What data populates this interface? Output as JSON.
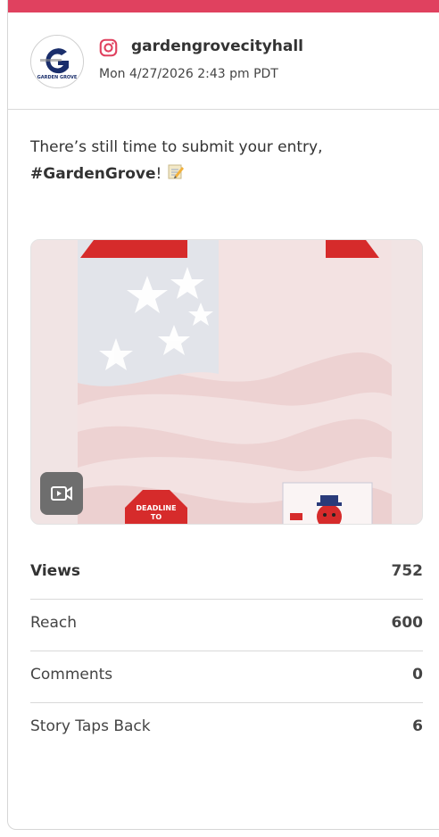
{
  "post": {
    "username": "gardengrovecityhall",
    "timestamp": "Mon 4/27/2026 2:43 pm PDT",
    "avatar_text": "GARDEN GROVE",
    "caption_prefix": "There’s still time to submit your entry, ",
    "hashtag": "#GardenGrove",
    "caption_suffix": "! ",
    "platform_icon": "instagram-icon",
    "media_icon": "video-icon",
    "media_labels": {
      "deadline_line1": "DEADLINE",
      "deadline_line2": "TO"
    }
  },
  "stats": [
    {
      "label": "Views",
      "value": "752"
    },
    {
      "label": "Reach",
      "value": "600"
    },
    {
      "label": "Comments",
      "value": "0"
    },
    {
      "label": "Story Taps Back",
      "value": "6"
    }
  ],
  "colors": {
    "accent": "#e0415f",
    "deadline_red": "#d62b2b"
  }
}
